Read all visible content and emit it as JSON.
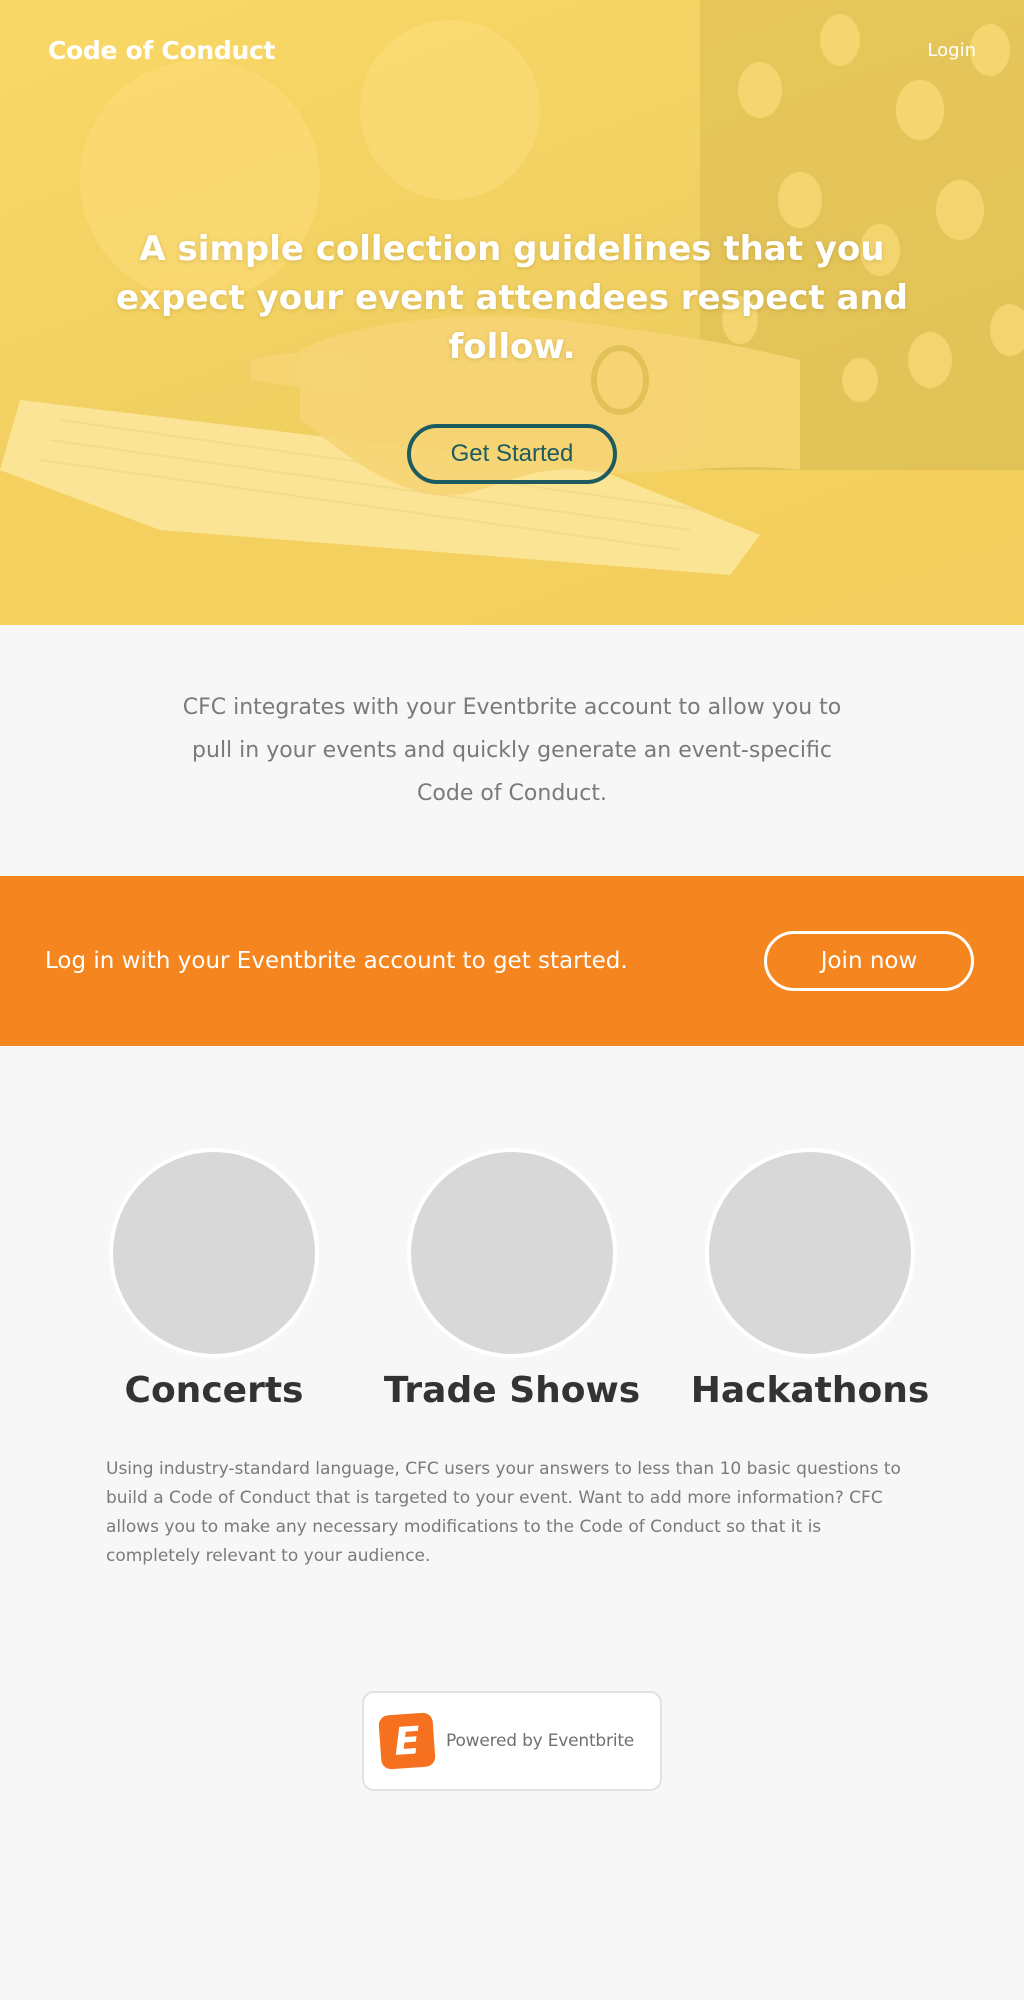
{
  "header": {
    "brand": "Code of Conduct",
    "login_label": "Login"
  },
  "hero": {
    "title": "A simple collection guidelines that you expect your event attendees respect and follow.",
    "cta_label": "Get Started",
    "cta_color": "#1e5b5f"
  },
  "intro": {
    "text": "CFC integrates with your Eventbrite account to allow you to pull in your events and quickly generate an event-specific Code of Conduct."
  },
  "banner": {
    "text": "Log in with your Eventbrite account to get started.",
    "button_label": "Join now",
    "background_color": "#f5851f"
  },
  "features": {
    "items": [
      {
        "label": "Concerts"
      },
      {
        "label": "Trade Shows"
      },
      {
        "label": "Hackathons"
      }
    ],
    "description": "Using industry-standard language, CFC users your answers to less than 10 basic questions to build a Code of Conduct that is targeted to your event. Want to add more information? CFC allows you to make any necessary modifications to the Code of Conduct so that it is completely relevant to your audience."
  },
  "footer": {
    "powered_logo_letter": "E",
    "powered_label": "Powered by Eventbrite",
    "logo_color": "#f5701f"
  }
}
